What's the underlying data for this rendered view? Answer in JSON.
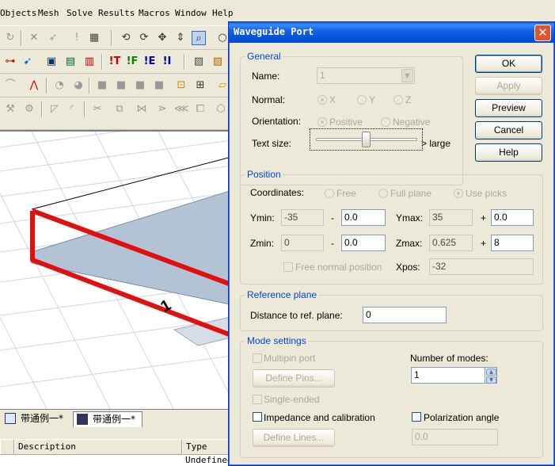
{
  "menu": [
    "Objects",
    "Mesh",
    "Solve",
    "Results",
    "Macros",
    "Window",
    "Help"
  ],
  "tabs": [
    "带通例一*",
    "带通例一*"
  ],
  "table": {
    "headers": [
      "Description",
      "Type"
    ],
    "row": [
      "",
      "Undefined"
    ]
  },
  "viewport": {
    "port_label": "1"
  },
  "dialog": {
    "title": "Waveguide Port",
    "buttons": {
      "ok": "OK",
      "apply": "Apply",
      "preview": "Preview",
      "cancel": "Cancel",
      "help": "Help"
    },
    "general": {
      "title": "General",
      "name_label": "Name:",
      "name_value": "1",
      "normal_label": "Normal:",
      "normal_options": [
        "X",
        "Y",
        "Z"
      ],
      "normal_selected": "X",
      "orientation_label": "Orientation:",
      "orientation_options": [
        "Positive",
        "Negative"
      ],
      "orientation_selected": "Positive",
      "text_size_label": "Text size:",
      "text_size_suffix": "> large",
      "text_size_level": 0.5
    },
    "position": {
      "title": "Position",
      "coordinates_label": "Coordinates:",
      "coord_options": [
        "Free",
        "Full plane",
        "Use picks"
      ],
      "coord_selected": "Use picks",
      "ymin_label": "Ymin:",
      "ymin": "-35",
      "ymin_off": "0.0",
      "ymax_label": "Ymax:",
      "ymax": "35",
      "ymax_off": "0.0",
      "zmin_label": "Zmin:",
      "zmin": "0",
      "zmin_off": "0.0",
      "zmax_label": "Zmax:",
      "zmax": "0.625",
      "zmax_off": "8",
      "minus": "-",
      "plus": "+",
      "free_normal_label": "Free normal position",
      "xpos_label": "Xpos:",
      "xpos": "-32"
    },
    "reference": {
      "title": "Reference plane",
      "distance_label": "Distance to ref. plane:",
      "distance_value": "0"
    },
    "mode": {
      "title": "Mode settings",
      "multipin_label": "Multipin port",
      "define_pins": "Define Pins...",
      "num_modes_label": "Number of modes:",
      "num_modes": "1",
      "single_ended_label": "Single-ended",
      "impedance_label": "Impedance and calibration",
      "polarization_label": "Polarization angle",
      "define_lines": "Define Lines...",
      "polarization_value": "0.0"
    }
  }
}
